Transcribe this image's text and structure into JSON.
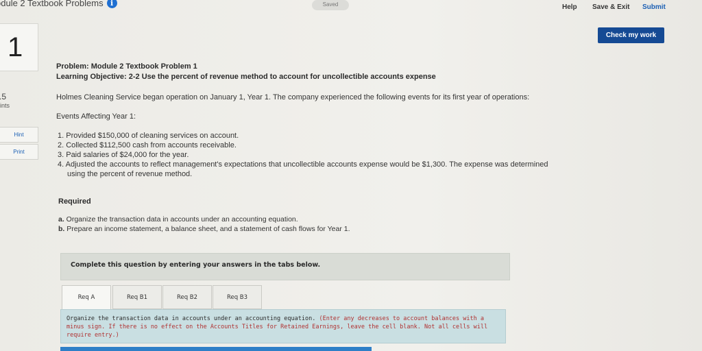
{
  "header": {
    "module_title": "odule 2 Textbook Problems",
    "info_icon": "info-icon",
    "saved_label": "Saved",
    "help_label": "Help",
    "save_exit_label": "Save & Exit",
    "submit_label": "Submit",
    "check_label": "Check my work"
  },
  "sidebar": {
    "question_number": "1",
    "points_value": ".5",
    "points_label": "oints",
    "hint_label": "Hint",
    "print_label": "Print"
  },
  "problem": {
    "title": "Problem: Module 2 Textbook Problem 1",
    "objective": "Learning Objective: 2-2 Use the percent of revenue method to account for uncollectible accounts expense",
    "intro": "Holmes Cleaning Service began operation on January 1, Year 1. The company experienced the following events for its first year of operations:",
    "events_heading": "Events Affecting Year 1:",
    "events": [
      "1. Provided $150,000 of cleaning services on account.",
      "2. Collected $112,500 cash from accounts receivable.",
      "3. Paid salaries of $24,000 for the year.",
      "4. Adjusted the accounts to reflect management's expectations that uncollectible accounts expense would be $1,300. The expense was determined using the percent of revenue method."
    ],
    "required_heading": "Required",
    "required": [
      {
        "letter": "a.",
        "text": " Organize the transaction data in accounts under an accounting equation."
      },
      {
        "letter": "b.",
        "text": " Prepare an income statement, a balance sheet, and a statement of cash flows for Year 1."
      }
    ]
  },
  "answer": {
    "instruction": "Complete this question by entering your answers in the tabs below.",
    "tabs": [
      {
        "label": "Req A",
        "active": true
      },
      {
        "label": "Req B1",
        "active": false
      },
      {
        "label": "Req B2",
        "active": false
      },
      {
        "label": "Req B3",
        "active": false
      }
    ],
    "panel_text": "Organize the transaction data in accounts under an accounting equation.",
    "panel_note": " (Enter any decreases to account balances with a minus sign. If there is no effect on the Accounts Titles for Retained Earnings, leave the cell blank. Not all cells will require entry.)"
  },
  "colors": {
    "accent": "#1a5fb4",
    "check_button": "#154a94",
    "panel": "#c9dfe2",
    "note_red": "#b03030"
  }
}
